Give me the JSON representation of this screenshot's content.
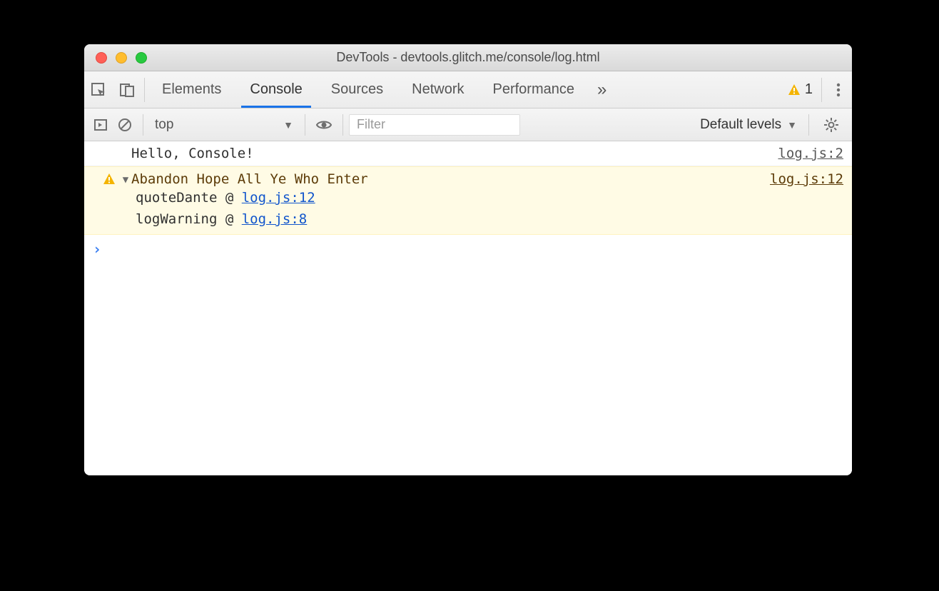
{
  "window": {
    "title": "DevTools - devtools.glitch.me/console/log.html"
  },
  "tabstrip": {
    "tabs": [
      "Elements",
      "Console",
      "Sources",
      "Network",
      "Performance"
    ],
    "active_index": 1,
    "overflow_glyph": "»",
    "warning_badge_count": "1"
  },
  "toolbar": {
    "context": "top",
    "filter_placeholder": "Filter",
    "levels_label": "Default levels"
  },
  "console": {
    "entries": [
      {
        "type": "info",
        "message": "Hello, Console!",
        "source": "log.js:2"
      },
      {
        "type": "warning",
        "expanded": true,
        "message": "Abandon Hope All Ye Who Enter",
        "source": "log.js:12",
        "stack": [
          {
            "fn": "quoteDante",
            "loc": "log.js:12"
          },
          {
            "fn": "logWarning",
            "loc": "log.js:8"
          }
        ]
      }
    ],
    "prompt_glyph": "›"
  }
}
